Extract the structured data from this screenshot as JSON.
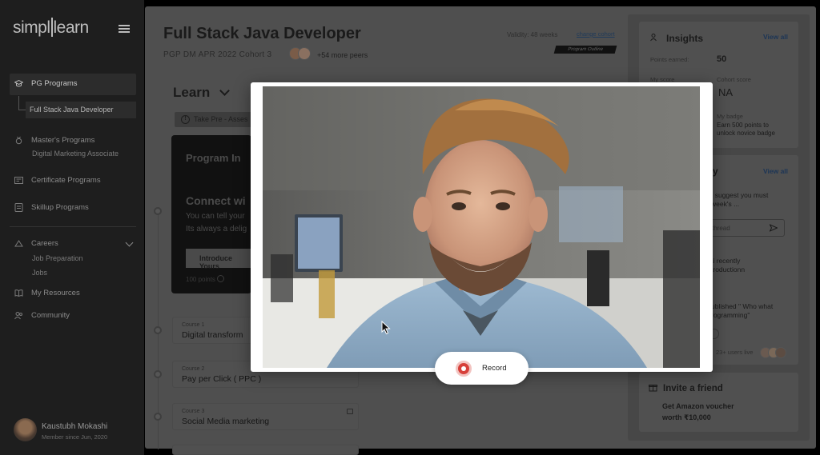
{
  "sidebar": {
    "logo_left": "simpl",
    "logo_right": "learn",
    "items": [
      {
        "label": "PG Programs",
        "icon": "graduation-cap-icon"
      },
      {
        "label": "Master's Programs",
        "icon": "medal-icon"
      },
      {
        "label": "Certificate Programs",
        "icon": "certificate-icon"
      },
      {
        "label": "Skillup Programs",
        "icon": "skillup-icon"
      },
      {
        "label": "Careers",
        "icon": "careers-icon"
      },
      {
        "label": "My Resources",
        "icon": "book-icon"
      },
      {
        "label": "Community",
        "icon": "community-icon"
      }
    ],
    "pg_sub": "Full Stack Java Developer",
    "masters_sub": "Digital Marketing Associate",
    "careers_sub": [
      "Job Preparation",
      "Jobs"
    ],
    "user_name": "Kaustubh Mokashi",
    "user_since": "Member since Jun, 2020"
  },
  "header": {
    "title": "Full Stack Java Developer",
    "cohort": "PGP DM APR 2022 Cohort 3",
    "peers": "+54 more peers",
    "validity": "Validity: 48 weeks",
    "change_cohort": "change cohort",
    "program_outline": "Program Outline"
  },
  "learn": {
    "heading": "Learn",
    "pre_assessment": "Take Pre - Asses",
    "card_title": "Program In",
    "connect": "Connect wi",
    "line1": "You can tell your",
    "line2": "Its always a delig",
    "button": "Introduce Yours",
    "points": "100 points"
  },
  "courses": [
    {
      "num": "Course 1",
      "name": "Digital transform",
      "locked": false
    },
    {
      "num": "Course 2",
      "name": "Pay per Click ( PPC )",
      "locked": false
    },
    {
      "num": "Course 3",
      "name": "Social Media marketing",
      "locked": true
    }
  ],
  "insights": {
    "title": "Insights",
    "view_all": "View all",
    "points_label": "Points earned:",
    "points_value": "50",
    "my_score_label": "My score",
    "cohort_score_label": "Cohort score",
    "cohort_score_value": "NA",
    "badge_label": "My badge",
    "badge_text_1": "Earn 500 points to",
    "badge_text_2": "unlock novice badge"
  },
  "activity": {
    "title_fragment": "ty",
    "view_all": "View all",
    "msg1_line1": "I suggest you must",
    "msg1_line2": "week's ...",
    "thread_placeholder": "thread",
    "msg2_line1": "ti recently",
    "msg2_line2": "troductionn",
    "msg3_line1": "ublished \" Who what",
    "msg3_line2": "rogramming\"",
    "users_live": "23+ users live"
  },
  "invite": {
    "title": "Invite a friend",
    "line1": "Get Amazon voucher",
    "line2": "worth ₹10,000"
  },
  "modal": {
    "record_label": "Record"
  },
  "colors": {
    "record_red": "#d7403a",
    "link_blue": "#1c3556"
  }
}
